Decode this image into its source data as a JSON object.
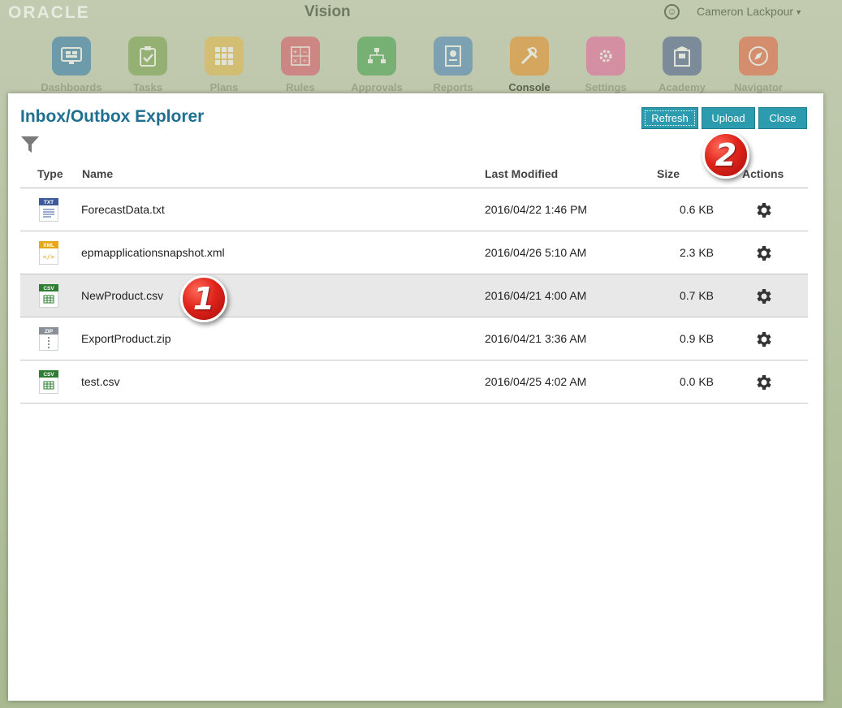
{
  "header": {
    "logo": "ORACLE",
    "app_title": "Vision",
    "user": "Cameron Lackpour",
    "accessibility_icon": "accessibility-icon"
  },
  "nav": [
    {
      "label": "Dashboards",
      "icon": "dashboard-icon",
      "color": "#1f6fa8",
      "active": false
    },
    {
      "label": "Tasks",
      "icon": "clipboard-check-icon",
      "color": "#6a9a3a",
      "active": false
    },
    {
      "label": "Plans",
      "icon": "grid-icon",
      "color": "#e6b53a",
      "active": false
    },
    {
      "label": "Rules",
      "icon": "calculator-icon",
      "color": "#d9475a",
      "active": false
    },
    {
      "label": "Approvals",
      "icon": "hierarchy-icon",
      "color": "#2f9a3a",
      "active": false
    },
    {
      "label": "Reports",
      "icon": "report-icon",
      "color": "#3a7ab8",
      "active": false
    },
    {
      "label": "Console",
      "icon": "tools-icon",
      "color": "#e58a1f",
      "active": true
    },
    {
      "label": "Settings",
      "icon": "settings-icon",
      "color": "#e8569a",
      "active": false
    },
    {
      "label": "Academy",
      "icon": "academy-icon",
      "color": "#3a4f86",
      "active": false
    },
    {
      "label": "Navigator",
      "icon": "compass-icon",
      "color": "#e8552f",
      "active": false
    }
  ],
  "modal": {
    "title": "Inbox/Outbox Explorer",
    "buttons": {
      "refresh": "Refresh",
      "upload": "Upload",
      "close": "Close"
    },
    "columns": {
      "type": "Type",
      "name": "Name",
      "modified": "Last Modified",
      "size": "Size",
      "actions": "Actions"
    },
    "files": [
      {
        "type_label": "TXT",
        "type_color": "#3d5a9c",
        "name": "ForecastData.txt",
        "modified": "2016/04/22 1:46 PM",
        "size": "0.6 KB"
      },
      {
        "type_label": "XML",
        "type_color": "#e6a817",
        "name": "epmapplicationsnapshot.xml",
        "modified": "2016/04/26 5:10 AM",
        "size": "2.3 KB"
      },
      {
        "type_label": "CSV",
        "type_color": "#2e7d32",
        "name": "NewProduct.csv",
        "modified": "2016/04/21 4:00 AM",
        "size": "0.7 KB"
      },
      {
        "type_label": "ZIP",
        "type_color": "#8a9098",
        "name": "ExportProduct.zip",
        "modified": "2016/04/21 3:36 AM",
        "size": "0.9 KB"
      },
      {
        "type_label": "CSV",
        "type_color": "#2e7d32",
        "name": "test.csv",
        "modified": "2016/04/25 4:02 AM",
        "size": "0.0 KB"
      }
    ],
    "selected_row": 2
  },
  "callouts": [
    "1",
    "2"
  ]
}
